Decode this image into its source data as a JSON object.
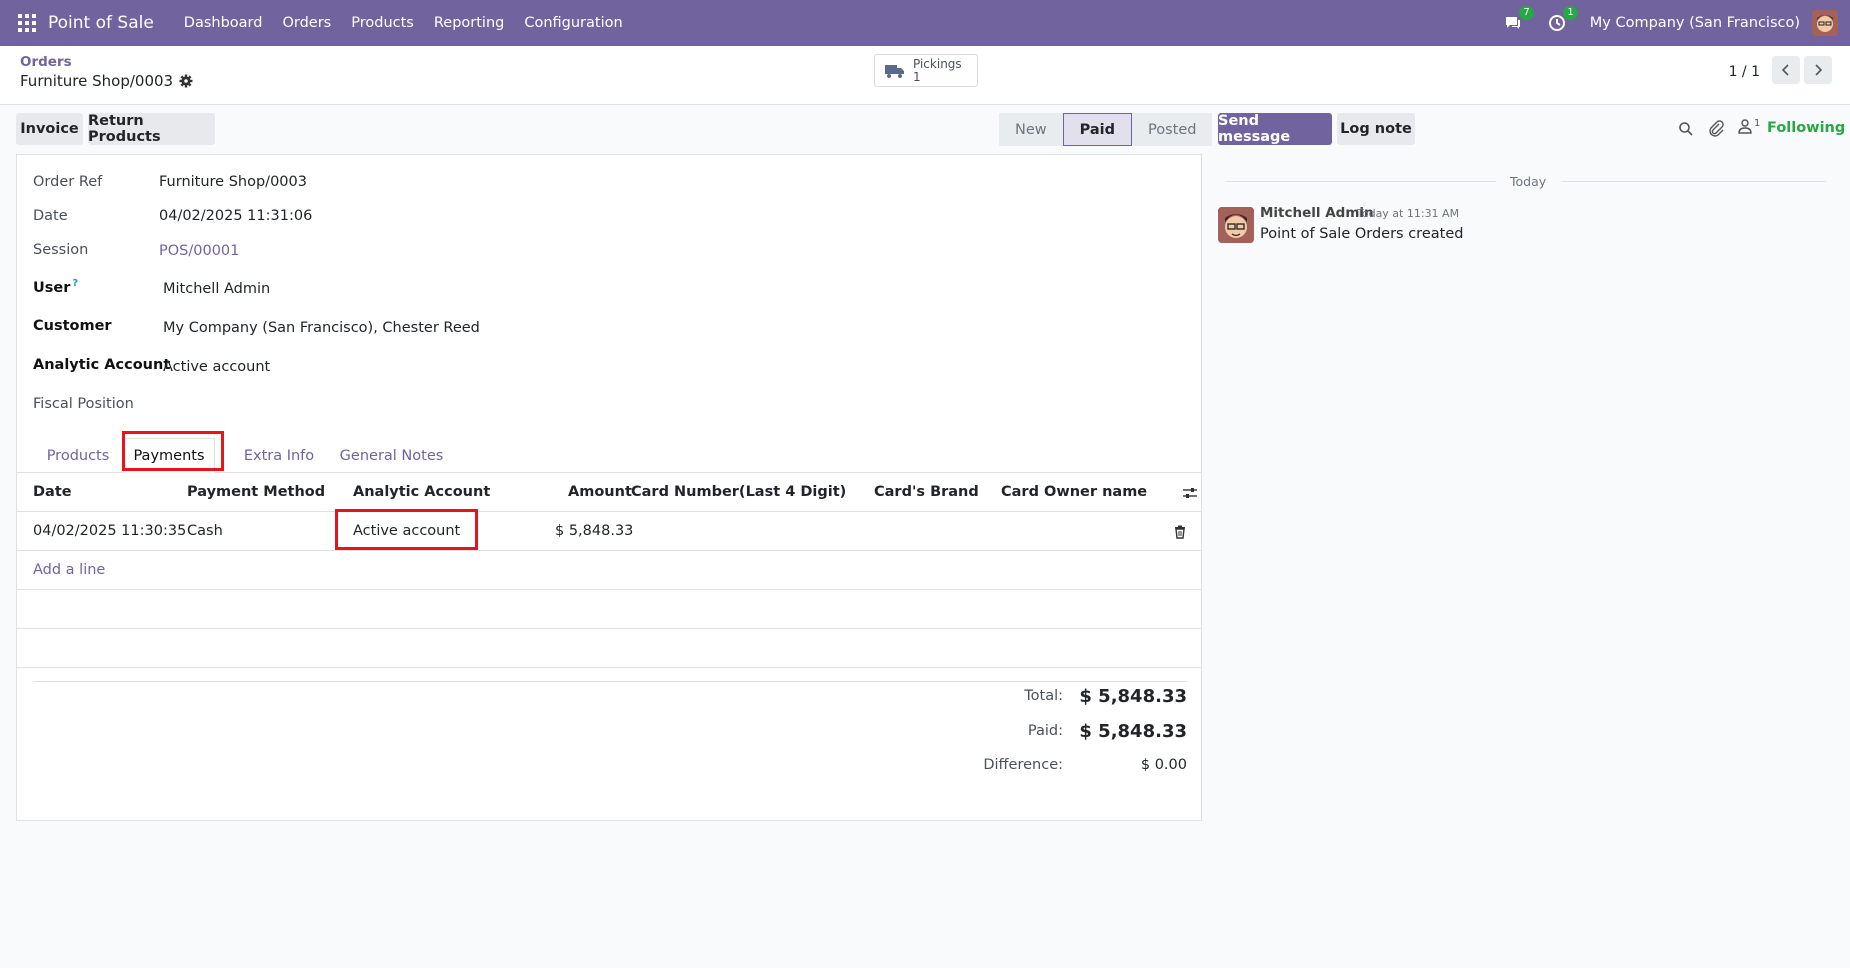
{
  "topbar": {
    "app_name": "Point of Sale",
    "nav": [
      "Dashboard",
      "Orders",
      "Products",
      "Reporting",
      "Configuration"
    ],
    "messages_count": "7",
    "activities_count": "1",
    "company": "My Company (San Francisco)"
  },
  "breadcrumb": {
    "parent": "Orders",
    "current": "Furniture Shop/0003"
  },
  "pickings": {
    "label": "Pickings",
    "count": "1"
  },
  "pager": {
    "text": "1 / 1"
  },
  "actions": {
    "invoice": "Invoice",
    "return_products": "Return Products"
  },
  "statusbar": [
    "New",
    "Paid",
    "Posted"
  ],
  "chatter_actions": {
    "send_message": "Send message",
    "log_note": "Log note",
    "followers_count": "1",
    "following": "Following"
  },
  "form": {
    "order_ref_label": "Order Ref",
    "order_ref": "Furniture Shop/0003",
    "date_label": "Date",
    "date": "04/02/2025 11:31:06",
    "session_label": "Session",
    "session": "POS/00001",
    "user_label": "User",
    "user_help": "?",
    "user": "Mitchell Admin",
    "customer_label": "Customer",
    "customer": "My Company (San Francisco), Chester Reed",
    "analytic_label": "Analytic Account",
    "analytic": "Active account",
    "fiscal_label": "Fiscal Position"
  },
  "tabs": [
    "Products",
    "Payments",
    "Extra Info",
    "General Notes"
  ],
  "payments": {
    "columns": [
      "Date",
      "Payment Method",
      "Analytic Account",
      "Amount",
      "Card Number(Last 4 Digit)",
      "Card's Brand",
      "Card Owner name"
    ],
    "rows": [
      {
        "date": "04/02/2025 11:30:35",
        "method": "Cash",
        "analytic": "Active account",
        "amount": "$ 5,848.33"
      }
    ],
    "add_line": "Add a line"
  },
  "totals": {
    "total_label": "Total:",
    "total": "$ 5,848.33",
    "paid_label": "Paid:",
    "paid": "$ 5,848.33",
    "difference_label": "Difference:",
    "difference": "$ 0.00"
  },
  "chatter": {
    "date_separator": "Today",
    "author": "Mitchell Admin",
    "time": "Today at 11:31 AM",
    "body": "Point of Sale Orders created"
  },
  "colors": {
    "brand": "#71639e",
    "highlight": "#e8131b",
    "following": "#28a745"
  }
}
